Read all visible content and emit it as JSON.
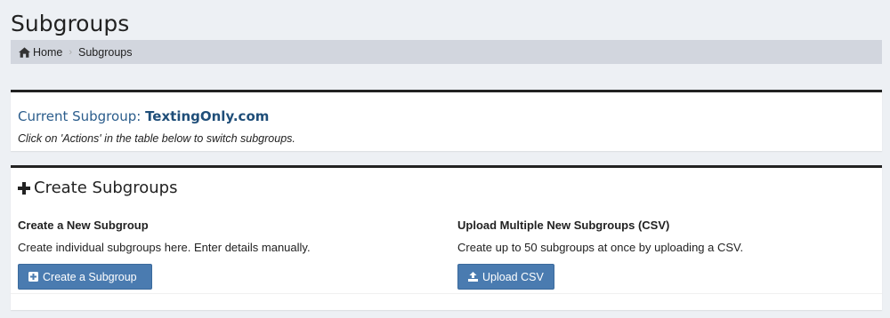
{
  "page": {
    "title": "Subgroups"
  },
  "breadcrumb": {
    "home": "Home",
    "current": "Subgroups"
  },
  "current_subgroup": {
    "label": "Current Subgroup:",
    "value": "TextingOnly.com",
    "hint": "Click on 'Actions' in the table below to switch subgroups."
  },
  "create_section": {
    "title": "Create Subgroups",
    "left": {
      "heading": "Create a New Subgroup",
      "description": "Create individual subgroups here. Enter details manually.",
      "button": "Create a Subgroup"
    },
    "right": {
      "heading": "Upload Multiple New Subgroups (CSV)",
      "description": "Create up to 50 subgroups at once by uploading a CSV.",
      "button": "Upload CSV"
    }
  },
  "colors": {
    "accent": "#4a7bb0",
    "link": "#2b5d8c",
    "background": "#edf0f4",
    "breadcrumb_bg": "#d2d6de"
  },
  "icons": {
    "home": "home-icon",
    "plus": "plus-icon",
    "plus_square": "plus-square-icon",
    "upload": "upload-icon"
  }
}
